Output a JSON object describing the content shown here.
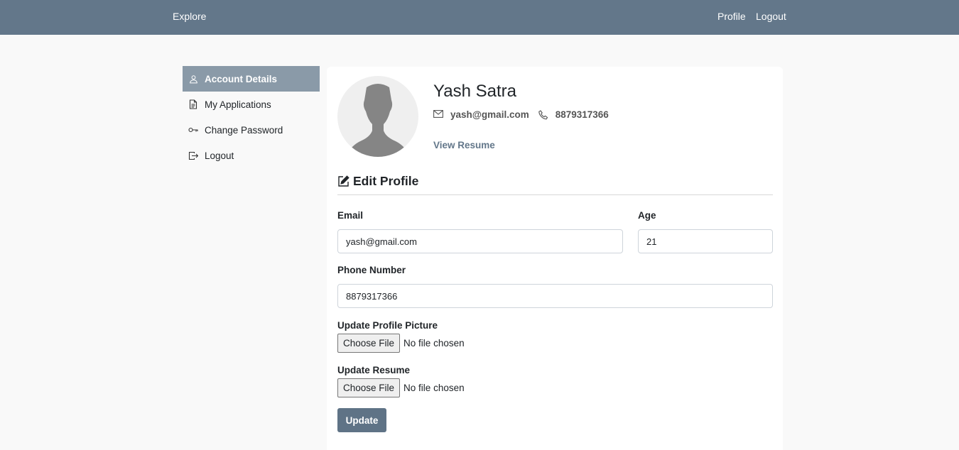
{
  "nav": {
    "brand": "Explore",
    "profile": "Profile",
    "logout": "Logout"
  },
  "sidebar": {
    "items": [
      {
        "label": "Account Details",
        "icon": "user-icon",
        "active": true
      },
      {
        "label": "My Applications",
        "icon": "document-icon",
        "active": false
      },
      {
        "label": "Change Password",
        "icon": "key-icon",
        "active": false
      },
      {
        "label": "Logout",
        "icon": "logout-icon",
        "active": false
      }
    ]
  },
  "profile": {
    "name": "Yash Satra",
    "email": "yash@gmail.com",
    "phone": "8879317366",
    "view_resume": "View Resume"
  },
  "form": {
    "title": "Edit Profile",
    "email_label": "Email",
    "email_value": "yash@gmail.com",
    "age_label": "Age",
    "age_value": "21",
    "phone_label": "Phone Number",
    "phone_value": "8879317366",
    "picture_label": "Update Profile Picture",
    "resume_label": "Update Resume",
    "choose_file": "Choose File",
    "no_file": "No file chosen",
    "update": "Update"
  },
  "colors": {
    "navbar": "#63778a",
    "active_sidebar": "#8a9aa8",
    "button": "#5f7386"
  }
}
